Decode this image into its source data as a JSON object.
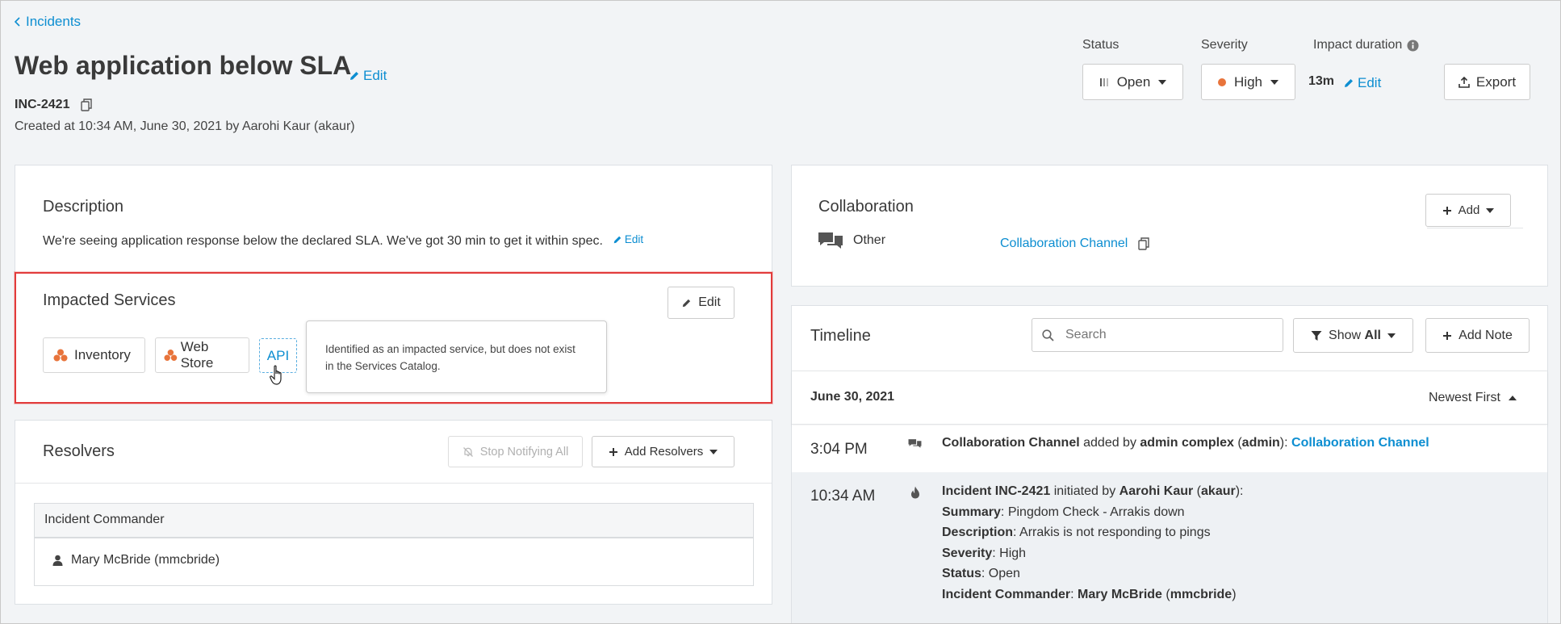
{
  "breadcrumb": {
    "back_label": "Incidents"
  },
  "incident": {
    "title": "Web application below SLA",
    "edit_label": "Edit",
    "id": "INC-2421",
    "created": "Created at 10:34 AM, June 30, 2021 by Aarohi Kaur (akaur)"
  },
  "header": {
    "status_label": "Status",
    "status_value": "Open",
    "severity_label": "Severity",
    "severity_value": "High",
    "severity_color": "#e8743b",
    "impact_label": "Impact duration",
    "impact_value": "13m",
    "impact_edit": "Edit",
    "export_label": "Export"
  },
  "description": {
    "title": "Description",
    "text": "We're seeing application response below the declared SLA. We've got 30 min to get it within spec.",
    "edit_label": "Edit"
  },
  "impacted_services": {
    "title": "Impacted Services",
    "edit_label": "Edit",
    "services": [
      "Inventory",
      "Web Store"
    ],
    "api_label": "API",
    "tooltip_line1": "Identified as an impacted service, but does not exist",
    "tooltip_line2": "in the Services Catalog.",
    "service_icon_color": "#e8743b"
  },
  "resolvers": {
    "title": "Resolvers",
    "stop_label": "Stop Notifying All",
    "add_label": "Add Resolvers",
    "table_header": "Incident Commander",
    "commander": "Mary McBride (mmcbride)"
  },
  "collaboration": {
    "title": "Collaboration",
    "add_label": "Add",
    "type": "Other",
    "channel_label": "Collaboration Channel"
  },
  "timeline": {
    "title": "Timeline",
    "search_placeholder": "Search",
    "show_prefix": "Show",
    "show_value": "All",
    "add_note": "Add Note",
    "date": "June 30, 2021",
    "sort_label": "Newest First",
    "entries": [
      {
        "time": "3:04 PM",
        "p1": "Collaboration Channel",
        "p2": " added by ",
        "p3": "admin complex",
        "p4": " (",
        "p5": "admin",
        "p6": "): ",
        "link": "Collaboration Channel"
      },
      {
        "time": "10:34 AM",
        "l1a": "Incident INC-2421",
        "l1b": " initiated by ",
        "l1c": "Aarohi Kaur",
        "l1d": " (",
        "l1e": "akaur",
        "l1f": "):",
        "summary_k": "Summary",
        "summary_v": ": Pingdom Check - Arrakis down",
        "desc_k": "Description",
        "desc_v": ": Arrakis is not responding to pings",
        "sev_k": "Severity",
        "sev_v": ": High",
        "status_k": "Status",
        "status_v": ": Open",
        "ic_k": "Incident Commander",
        "ic_sep": ": ",
        "ic_v": "Mary McBride",
        "ic_po": " (",
        "ic_u": "mmcbride",
        "ic_pc": ")"
      }
    ]
  }
}
